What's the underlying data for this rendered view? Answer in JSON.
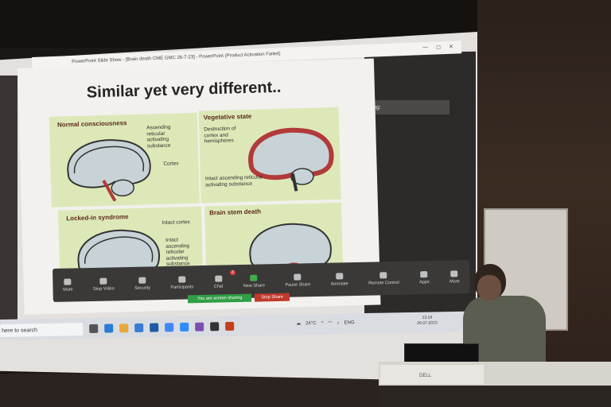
{
  "window": {
    "title": "PowerPoint Slide Show - [Brain death CME GMC 26-7-23] - PowerPoint (Product Activation Failed)",
    "controls": [
      "—",
      "◻",
      "✕"
    ]
  },
  "talking_indicator": "Talking:",
  "slide": {
    "title": "Similar yet very different..",
    "panels": [
      {
        "label": "Normal consciousness",
        "annotations": [
          "Ascending reticular activating substance",
          "Cortex"
        ]
      },
      {
        "label": "Vegetative state",
        "annotations": [
          "Destruction of cortex and hemispheres",
          "Intact ascending reticular activating substance"
        ]
      },
      {
        "label": "Locked-in syndrome",
        "annotations": [
          "Intact cortex",
          "Intact ascending reticular activating substance"
        ]
      },
      {
        "label": "Brain stem death",
        "annotations": []
      }
    ]
  },
  "zoom_toolbar": {
    "items": [
      "Mute",
      "Stop Video",
      "Security",
      "Participants",
      "Chat",
      "New Share",
      "Pause Share",
      "Annotate",
      "Remote Control",
      "Apps",
      "More"
    ],
    "participants_count": "3",
    "screen_sharing_banner": "You are screen sharing",
    "stop_share": "Stop Share"
  },
  "taskbar": {
    "search_placeholder": "here to search",
    "weather": "24°C",
    "language": "ENG",
    "time": "13:18",
    "date": "26-07-2023"
  },
  "desk": {
    "nameplate": "DELL"
  },
  "colors": {
    "slide_panel": "#dde8b8",
    "brain_fill": "#c7d3d6",
    "lesion": "#b23a3a",
    "toolbar": "#3b3938",
    "share_green": "#2f9e44",
    "stop_red": "#c0392b"
  }
}
